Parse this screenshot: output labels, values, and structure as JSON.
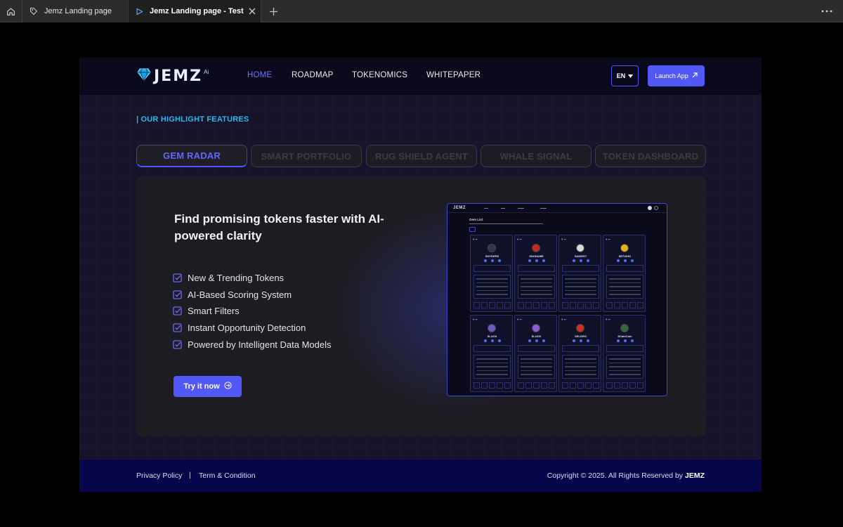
{
  "browser": {
    "tabs": [
      {
        "label": "Jemz Landing page",
        "active": false
      },
      {
        "label": "Jemz Landing page - Test UI",
        "active": true
      }
    ]
  },
  "header": {
    "logo": "JEMZ",
    "logo_suffix": "Ai",
    "nav": [
      "HOME",
      "ROADMAP",
      "TOKENOMICS",
      "WHITEPAPER"
    ],
    "active_nav": "HOME",
    "language": "EN",
    "launch_label": "Launch App"
  },
  "section": {
    "label": "| OUR HIGHLIGHT FEATURES"
  },
  "feature_tabs": [
    {
      "label": "GEM RADAR",
      "active": true
    },
    {
      "label": "SMART PORTFOLIO",
      "active": false
    },
    {
      "label": "RUG SHIELD AGENT",
      "active": false
    },
    {
      "label": "WHALE SIGNAL",
      "active": false
    },
    {
      "label": "TOKEN DASHBOARD",
      "active": false
    }
  ],
  "panel": {
    "headline": "Find promising tokens faster with AI-powered clarity",
    "features": [
      "New & Trending Tokens",
      "AI-Based Scoring System",
      "Smart Filters",
      "Instant Opportunity Detection",
      "Powered by Intelligent Data Models"
    ],
    "cta": "Try it now"
  },
  "preview": {
    "logo": "JEMZ",
    "title": "Gem List",
    "cards": [
      {
        "name": "SHYDERS",
        "avatar_color": "#2b3550"
      },
      {
        "name": "SNONAME",
        "avatar_color": "#c5281f"
      },
      {
        "name": "SAIDEST",
        "avatar_color": "#d9d9d9"
      },
      {
        "name": "$STUDIO",
        "avatar_color": "#e8b21a"
      },
      {
        "name": "SLUCK",
        "avatar_color": "#6f59c9"
      },
      {
        "name": "SLUCK",
        "avatar_color": "#8b5bd6"
      },
      {
        "name": "SELDRO",
        "avatar_color": "#d0301d"
      },
      {
        "name": "SCatsCoin",
        "avatar_color": "#2e6b3a"
      }
    ]
  },
  "footer": {
    "privacy": "Privacy Policy",
    "separator": "|",
    "terms": "Term & Condition",
    "copyright": "Copyright © 2025. All Rights Reserved by",
    "brand": "JEMZ"
  },
  "colors": {
    "accent": "#5258f5",
    "section_label": "#29b9e8",
    "page_bg": "#16132b",
    "footer_bg": "#07064a"
  }
}
